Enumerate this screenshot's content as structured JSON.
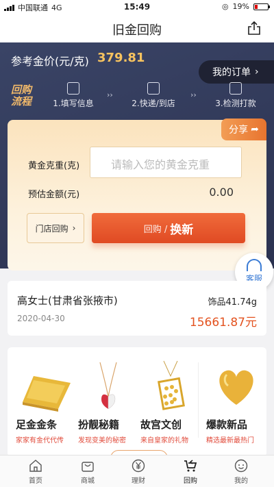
{
  "status": {
    "carrier": "中国联通",
    "network": "4G",
    "time": "15:49",
    "battery": "19%"
  },
  "nav": {
    "title": "旧金回购"
  },
  "hero": {
    "price_label": "参考金价(元/克)",
    "price_value": "379.81",
    "my_order": "我的订单",
    "flow_logo_line1": "回购",
    "flow_logo_line2": "流程",
    "steps": [
      "1.填写信息",
      "2.快递/到店",
      "3.检测打款"
    ]
  },
  "calc": {
    "share": "分享",
    "weight_label": "黄金克重(克)",
    "weight_placeholder": "请输入您的黄金克重",
    "estimate_label": "预估金额(元)",
    "estimate_value": "0.00",
    "store_button": "门店回购",
    "exchange_a": "回购 /",
    "exchange_b": "换新"
  },
  "service": {
    "label": "客服"
  },
  "record": {
    "name": "高女士(甘肃省张掖市)",
    "date": "2020-04-30",
    "weight": "饰品41.74g",
    "money": "15661.87元"
  },
  "products": [
    {
      "title": "足金金条",
      "subtitle": "家家有金代代传"
    },
    {
      "title": "扮靓秘籍",
      "subtitle": "发现变美的秘密"
    },
    {
      "title": "故宫文创",
      "subtitle": "来自皇家的礼物"
    },
    {
      "title": "爆款新品",
      "subtitle": "精选最新最热门"
    }
  ],
  "tabs": [
    {
      "label": "首页",
      "icon": "home-icon"
    },
    {
      "label": "商城",
      "icon": "bag-icon"
    },
    {
      "label": "理财",
      "icon": "yuan-icon"
    },
    {
      "label": "回购",
      "icon": "cart-return-icon"
    },
    {
      "label": "我的",
      "icon": "user-icon"
    }
  ],
  "colors": {
    "accent": "#e04a23",
    "gold": "#f7c35f",
    "hero_bg": "#2b3250"
  }
}
